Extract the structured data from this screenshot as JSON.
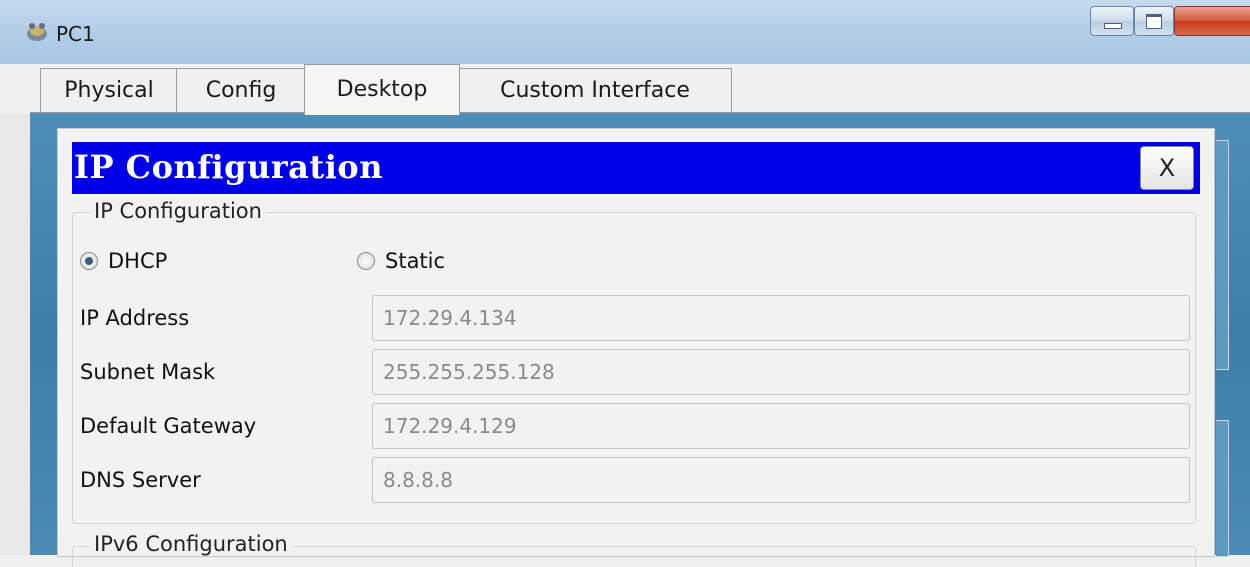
{
  "window": {
    "title": "PC1"
  },
  "tabs": [
    {
      "label": "Physical"
    },
    {
      "label": "Config"
    },
    {
      "label": "Desktop"
    },
    {
      "label": "Custom Interface"
    }
  ],
  "active_tab": "Desktop",
  "dialog": {
    "header_title": "IP Configuration",
    "close_label": "X",
    "group_label": "IP Configuration",
    "mode_options": [
      {
        "label": "DHCP",
        "checked": true
      },
      {
        "label": "Static",
        "checked": false
      }
    ],
    "fields": [
      {
        "label": "IP Address",
        "value": "172.29.4.134"
      },
      {
        "label": "Subnet Mask",
        "value": "255.255.255.128"
      },
      {
        "label": "Default Gateway",
        "value": "172.29.4.129"
      },
      {
        "label": "DNS Server",
        "value": "8.8.8.8"
      }
    ],
    "ipv6_group_label": "IPv6 Configuration"
  },
  "colors": {
    "header_blue": "#0000e6",
    "desktop_bg": "#3c7fa9"
  }
}
